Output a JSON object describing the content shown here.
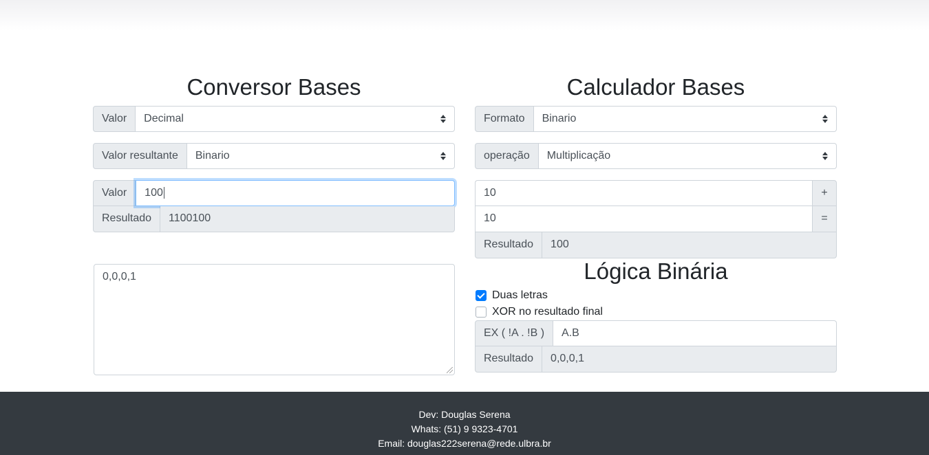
{
  "converter": {
    "title": "Conversor Bases",
    "from_label": "Valor",
    "from_selected": "Decimal",
    "to_label": "Valor resultante",
    "to_selected": "Binario",
    "value_label": "Valor",
    "value_input": "100",
    "result_label": "Resultado",
    "result_value": "1100100",
    "textarea_value": "0,0,0,1"
  },
  "calculator": {
    "title": "Calculador Bases",
    "format_label": "Formato",
    "format_selected": "Binario",
    "operation_label": "operação",
    "operation_selected": "Multiplicação",
    "operand1": "10",
    "operand1_button": "+",
    "operand2": "10",
    "operand2_button": "=",
    "result_label": "Resultado",
    "result_value": "100"
  },
  "logic": {
    "title": "Lógica Binária",
    "checkbox_two_letters": {
      "label": "Duas letras",
      "checked": true
    },
    "checkbox_xor": {
      "label": "XOR no resultado final",
      "checked": false
    },
    "expression_label": "EX ( !A . !B )",
    "expression_value": "A.B",
    "result_label": "Resultado",
    "result_value": "0,0,0,1"
  },
  "footer": {
    "dev": "Dev: Douglas Serena",
    "whats": "Whats: (51) 9 9323-4701",
    "email": "Email: douglas222serena@rede.ulbra.br"
  },
  "colors": {
    "accent": "#007bff",
    "footer_bg": "#343a40",
    "addon_bg": "#e9ecef"
  }
}
